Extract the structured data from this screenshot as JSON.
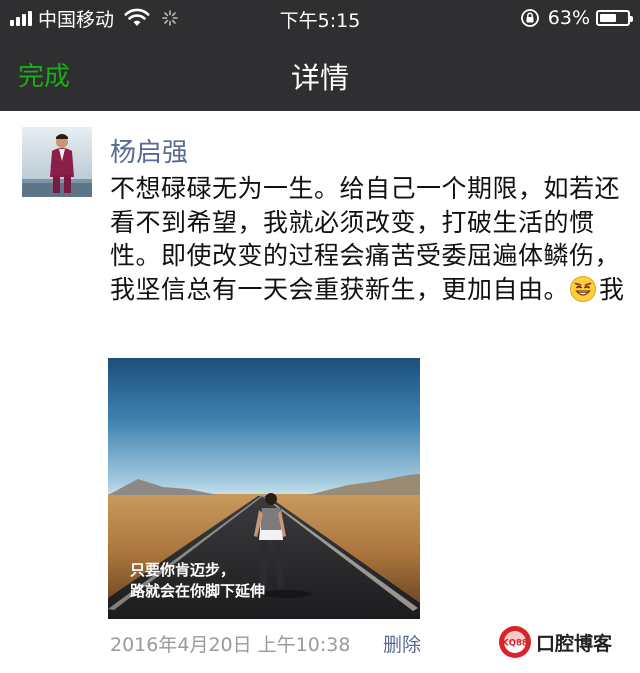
{
  "status_bar": {
    "carrier": "中国移动",
    "time": "下午5:15",
    "battery_percent": "63%",
    "battery_level": 0.63,
    "icons": [
      "signal-icon",
      "wifi-icon",
      "loading-spinner-icon",
      "orientation-lock-icon",
      "battery-icon"
    ]
  },
  "nav": {
    "done_label": "完成",
    "title": "详情"
  },
  "post": {
    "author": "杨启强",
    "text": "不想碌碌无为一生。给自己一个期限，如若还看不到希望，我就必须改变，打破生活的惯性。即使改变的过程会痛苦受委屈遍体鳞伤，我坚信总有一天会重获新生，更加自由。",
    "emoji_icon": "grin-emoji-icon",
    "trailing_text": "我",
    "image_caption": [
      "只要你肯迈步，",
      "路就会在你脚下延伸"
    ],
    "timestamp": "2016年4月20日 上午10:38",
    "delete_label": "删除"
  },
  "watermark": {
    "logo_text": "KQ88",
    "text": "口腔博客"
  },
  "colors": {
    "header_bg": "#2f2f31",
    "done_green": "#1aad19",
    "link_blue": "#576b95",
    "timestamp_gray": "#9a9a9a"
  }
}
